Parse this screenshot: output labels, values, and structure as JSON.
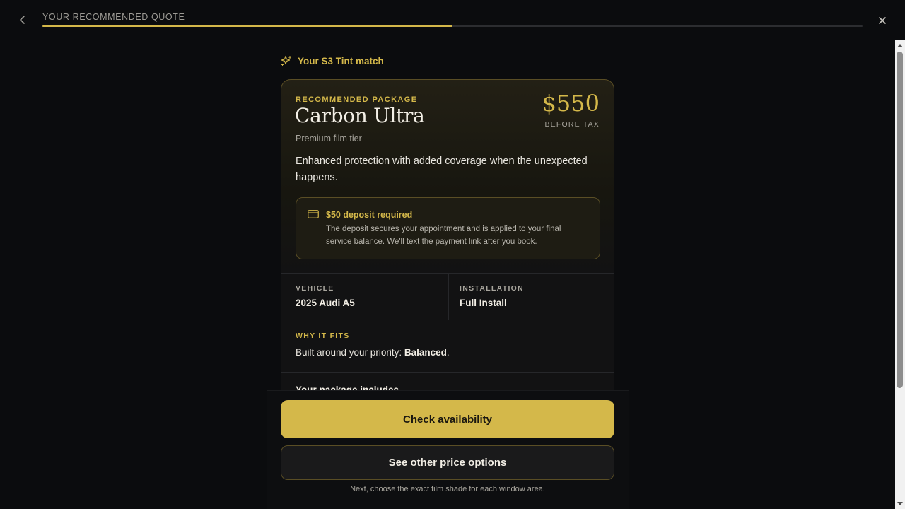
{
  "header": {
    "title": "YOUR RECOMMENDED QUOTE",
    "back_icon": "chevron-left-icon",
    "close_icon": "close-icon",
    "progress_percent": 50
  },
  "match": {
    "icon": "sparkle-icon",
    "label": "Your S3 Tint match"
  },
  "package": {
    "eyebrow": "RECOMMENDED PACKAGE",
    "name": "Carbon Ultra",
    "tier": "Premium film tier",
    "price": "$550",
    "price_note": "BEFORE TAX",
    "description": "Enhanced protection with added coverage when the unexpected happens."
  },
  "deposit": {
    "icon": "credit-card-icon",
    "title": "$50 deposit required",
    "text": "The deposit secures your appointment and is applied to your final service balance. We'll text the payment link after you book."
  },
  "specs": {
    "vehicle_label": "VEHICLE",
    "vehicle_value": "2025 Audi A5",
    "installation_label": "INSTALLATION",
    "installation_value": "Full Install"
  },
  "why": {
    "label": "WHY IT FITS",
    "prefix": "Built around your priority: ",
    "priority": "Balanced",
    "suffix": "."
  },
  "includes_title": "Your package includes",
  "actions": {
    "primary": "Check availability",
    "secondary": "See other price options",
    "note": "Next, choose the exact film shade for each window area."
  },
  "colors": {
    "accent": "#d4b84a",
    "background": "#0b0c0e",
    "border_accent": "#5a4e25"
  }
}
